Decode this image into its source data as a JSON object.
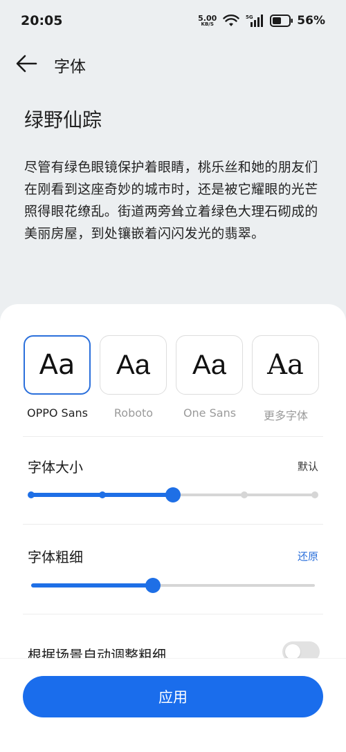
{
  "status_bar": {
    "time": "20:05",
    "net_speed_value": "5.00",
    "net_speed_unit": "KB/S",
    "network_label": "5G",
    "battery_percent": "56%",
    "battery_level": 0.56
  },
  "header": {
    "title": "字体"
  },
  "preview": {
    "title": "绿野仙踪",
    "text": "尽管有绿色眼镜保护着眼睛，桃乐丝和她的朋友们在刚看到这座奇妙的城市时，还是被它耀眼的光芒照得眼花缭乱。街道两旁耸立着绿色大理石砌成的美丽房屋，到处镶嵌着闪闪发光的翡翠。"
  },
  "fonts": {
    "sample": "Aa",
    "selected_index": 0,
    "options": [
      {
        "label": "OPPO Sans"
      },
      {
        "label": "Roboto"
      },
      {
        "label": "One Sans"
      },
      {
        "label": "更多字体"
      }
    ]
  },
  "font_size": {
    "title": "字体大小",
    "action": "默认",
    "steps": 5,
    "current_step": 2
  },
  "font_weight": {
    "title": "字体粗细",
    "action": "还原",
    "level": 0.43
  },
  "auto_weight": {
    "label": "根据场景自动调整粗细",
    "enabled": false
  },
  "apply_button": {
    "label": "应用"
  },
  "colors": {
    "accent": "#1a6dec",
    "background": "#eceff1",
    "sheet": "#ffffff"
  }
}
